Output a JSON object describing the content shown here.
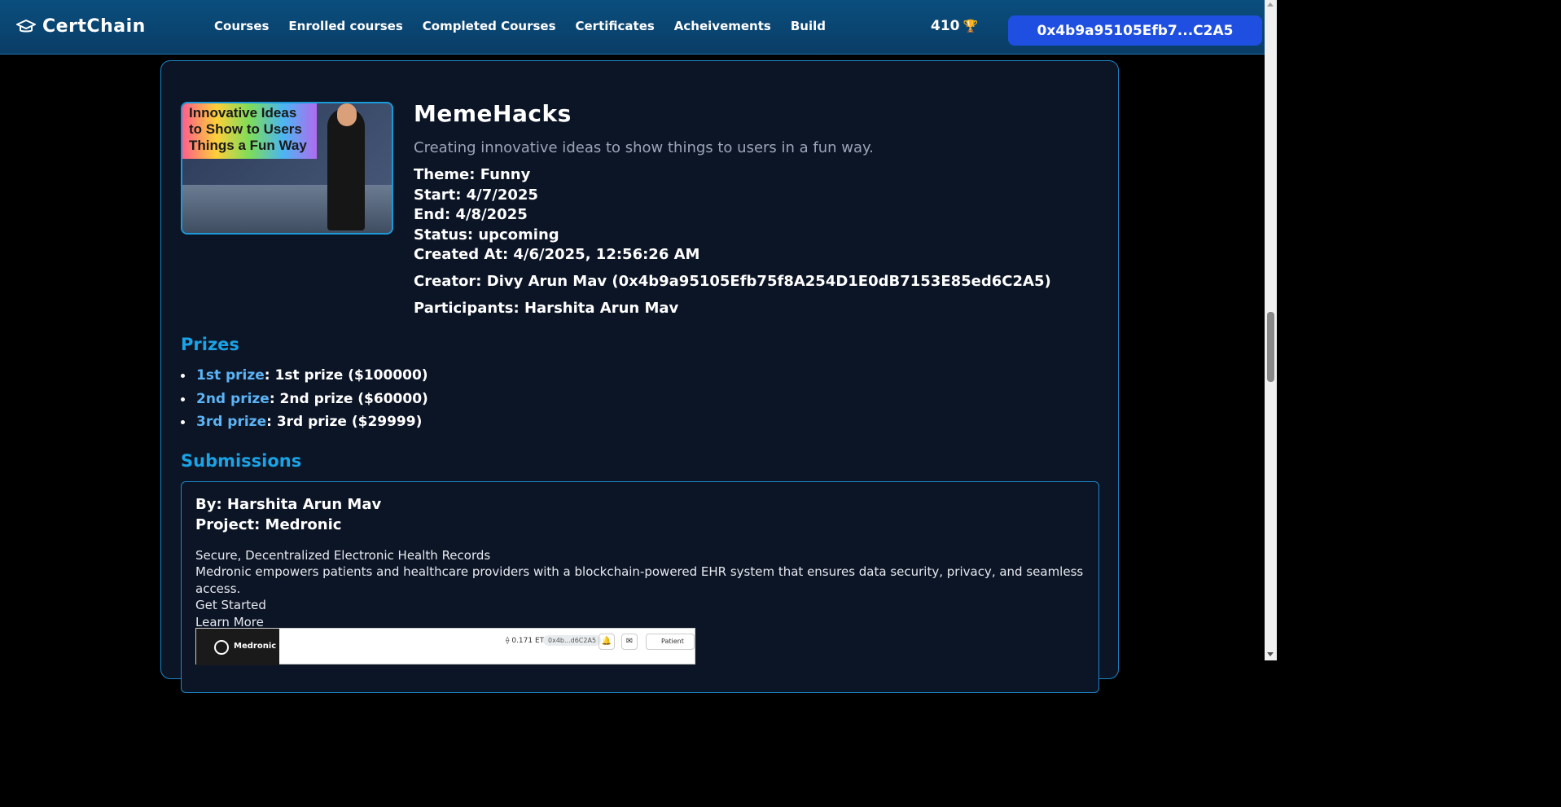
{
  "nav": {
    "brand": "CertChain",
    "links": [
      "Courses",
      "Enrolled courses",
      "Completed Courses",
      "Certificates",
      "Acheivements",
      "Build"
    ],
    "points": "410",
    "wallet": "0x4b9a95105Efb7...C2A5"
  },
  "hackathon": {
    "image_text": [
      "Innovative Ideas",
      "to Show to Users",
      "Things a Fun Way"
    ],
    "title": "MemeHacks",
    "description": "Creating innovative ideas to show things to users in a fun way.",
    "theme": "Theme: Funny",
    "start": "Start: 4/7/2025",
    "end": "End: 4/8/2025",
    "status": "Status: upcoming",
    "created": "Created At: 4/6/2025, 12:56:26 AM",
    "creator": "Creator: Divy Arun Mav (0x4b9a95105Efb75f8A254D1E0dB7153E85ed6C2A5)",
    "participants": "Participants: Harshita Arun Mav"
  },
  "prizes": {
    "heading": "Prizes",
    "items": [
      {
        "label": "1st prize",
        "detail": ": 1st prize ($100000)"
      },
      {
        "label": "2nd prize",
        "detail": ": 2nd prize ($60000)"
      },
      {
        "label": "3rd prize",
        "detail": ": 3rd prize ($29999)"
      }
    ]
  },
  "submissions": {
    "heading": "Submissions",
    "items": [
      {
        "by": "By: Harshita Arun Mav",
        "project": "Project: Medronic",
        "tagline": "Secure, Decentralized Electronic Health Records",
        "body": "Medronic empowers patients and healthcare providers with a blockchain-powered EHR system that ensures data security, privacy, and seamless access.",
        "cta_primary": "Get Started",
        "cta_secondary": "Learn More",
        "preview": {
          "app_name": "Medronic",
          "eth": "0.171 ETH",
          "address": "0x4b...d6C2A5",
          "role": "Patient"
        }
      }
    ]
  }
}
